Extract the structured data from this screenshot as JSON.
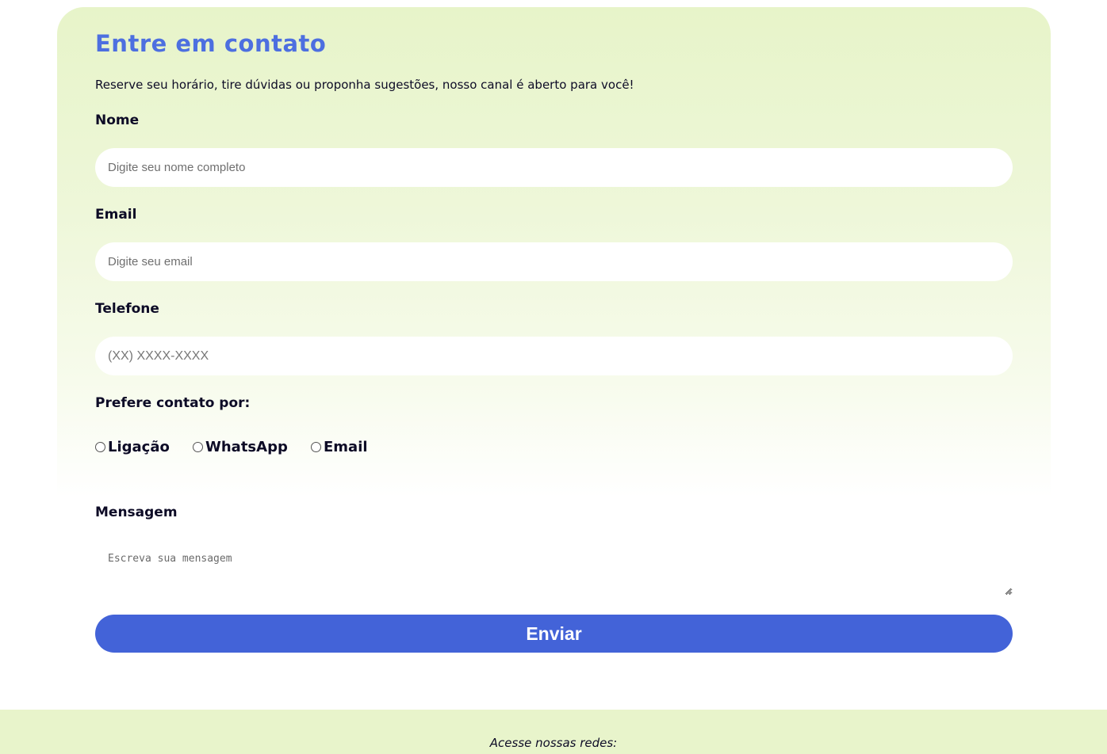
{
  "contact": {
    "title": "Entre em contato",
    "subtitle": "Reserve seu horário, tire dúvidas ou proponha sugestões, nosso canal é aberto para você!",
    "name_label": "Nome",
    "name_placeholder": "Digite seu nome completo",
    "email_label": "Email",
    "email_placeholder": "Digite seu email",
    "phone_label": "Telefone",
    "phone_placeholder": "(XX) XXXX-XXXX",
    "preference_label": "Prefere contato por:",
    "preference_options": [
      "Ligação",
      "WhatsApp",
      "Email"
    ],
    "message_label": "Mensagem",
    "message_placeholder": "Escreva sua mensagem",
    "submit_label": "Enviar"
  },
  "footer": {
    "text": "Acesse nossas redes:"
  },
  "colors": {
    "accent": "#4363d8",
    "title": "#4d6fe0",
    "card_background": "#e7f4c9",
    "footer_background": "#e8f4cb",
    "text": "#0d0b26"
  }
}
